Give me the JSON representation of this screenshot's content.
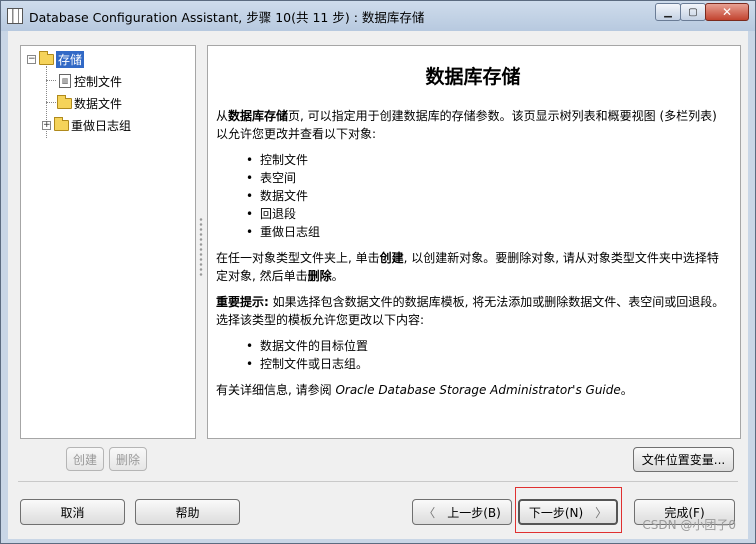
{
  "window": {
    "title": "Database Configuration Assistant, 步骤 10(共 11 步) : 数据库存储",
    "min_glyph": "▁",
    "max_glyph": "▢",
    "close_glyph": "✕"
  },
  "tree": {
    "root": {
      "label": "存储",
      "expander": "−"
    },
    "items": [
      {
        "label": "控制文件",
        "icon": "file-icon"
      },
      {
        "label": "数据文件",
        "icon": "folder-icon"
      },
      {
        "label": "重做日志组",
        "icon": "folder-icon",
        "expander": "+"
      }
    ]
  },
  "content": {
    "heading": "数据库存储",
    "intro_pre": "从",
    "intro_bold": "数据库存储",
    "intro_post": "页, 可以指定用于创建数据库的存储参数。该页显示树列表和概要视图 (多栏列表) 以允许您更改并查看以下对象:",
    "objects": [
      "控制文件",
      "表空间",
      "数据文件",
      "回退段",
      "重做日志组"
    ],
    "create_pre": "在任一对象类型文件夹上, 单击",
    "create_bold": "创建",
    "create_mid": ", 以创建新对象。要删除对象, 请从对象类型文件夹中选择特定对象, 然后单击",
    "create_bold2": "删除",
    "create_post": "。",
    "tip_bold": "重要提示:",
    "tip_text": " 如果选择包含数据文件的数据库模板, 将无法添加或删除数据文件、表空间或回退段。选择该类型的模板允许您更改以下内容:",
    "tip_items": [
      "数据文件的目标位置",
      "控制文件或日志组。"
    ],
    "more_pre": "有关详细信息, 请参阅 ",
    "more_italic": "Oracle Database Storage Administrator's Guide",
    "more_post": "。"
  },
  "buttons": {
    "create": "创建",
    "delete": "删除",
    "file_location_vars": "文件位置变量...",
    "cancel": "取消",
    "help": "帮助",
    "back": "上一步(B)",
    "back_arrow": "〈",
    "next": "下一步(N)",
    "next_arrow": "〉",
    "finish": "完成(F)"
  },
  "watermark": "CSDN @小团子0",
  "colors": {
    "selection": "#3169c6",
    "highlight_box": "#e03030"
  }
}
